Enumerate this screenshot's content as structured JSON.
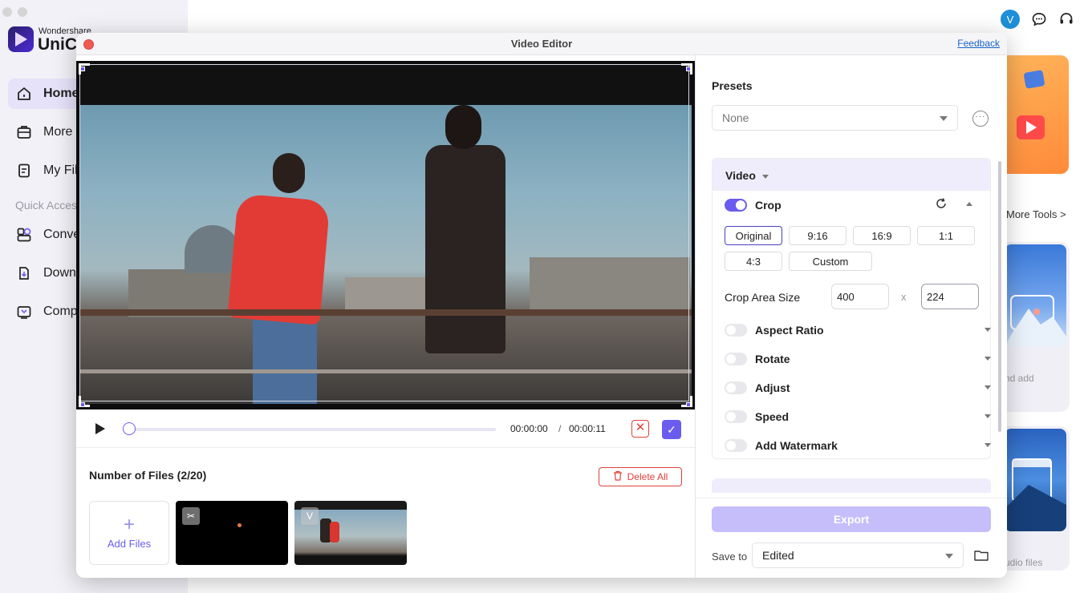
{
  "background": {
    "brand_small": "Wondershare",
    "brand_big": "UniCo",
    "nav": [
      {
        "label": "Home",
        "icon": "home-icon"
      },
      {
        "label": "More",
        "icon": "toolbox-icon"
      },
      {
        "label": "My Fil",
        "icon": "file-icon"
      }
    ],
    "quick_access_label": "Quick Acces",
    "quick_items": [
      {
        "label": "Conve",
        "icon": "convert-icon"
      },
      {
        "label": "Down",
        "icon": "download-icon"
      },
      {
        "label": "Comp",
        "icon": "compress-icon"
      }
    ],
    "avatar_letter": "V",
    "more_tools": "More Tools >",
    "card_text_1": "nd add",
    "card_text_2": "udio files"
  },
  "editor": {
    "title": "Video Editor",
    "feedback": "Feedback",
    "time_current": "00:00:00",
    "time_sep": "/",
    "time_total": "00:00:11",
    "playback_progress": 0,
    "files_title": "Number of Files (2/20)",
    "delete_all": "Delete All",
    "add_files": "Add Files",
    "presets_label": "Presets",
    "presets_value": "None",
    "video_section": "Video",
    "crop_label": "Crop",
    "ratios": [
      "Original",
      "9:16",
      "16:9",
      "1:1",
      "4:3",
      "Custom"
    ],
    "selected_ratio": "Original",
    "crop_size_label": "Crop Area Size",
    "crop_width": "400",
    "crop_x": "x",
    "crop_height": "224",
    "options": [
      {
        "label": "Aspect Ratio",
        "enabled": false
      },
      {
        "label": "Rotate",
        "enabled": false
      },
      {
        "label": "Adjust",
        "enabled": false
      },
      {
        "label": "Speed",
        "enabled": false
      },
      {
        "label": "Add Watermark",
        "enabled": false
      }
    ],
    "export": "Export",
    "save_to_label": "Save to",
    "save_to_value": "Edited"
  },
  "colors": {
    "accent": "#6b5cf0",
    "danger": "#e0403a",
    "export_disabled": "#c6bdfb"
  }
}
